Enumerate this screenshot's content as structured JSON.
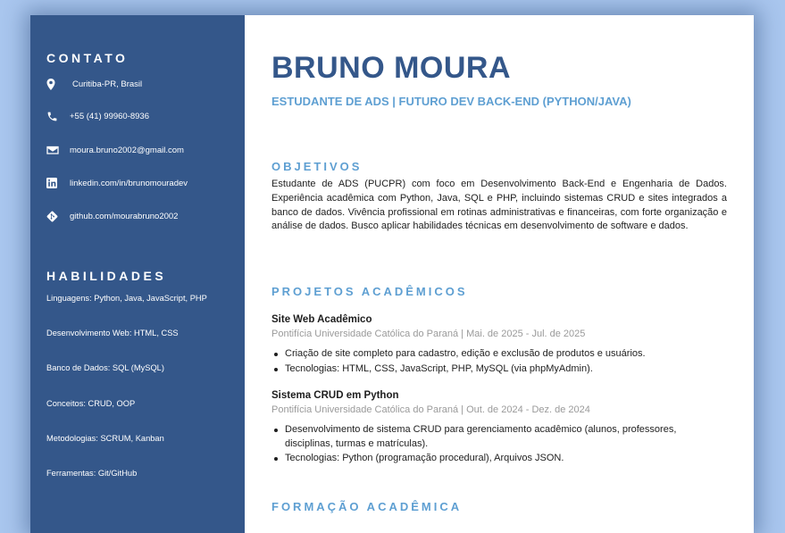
{
  "sidebar": {
    "contact_title": "CONTATO",
    "contacts": [
      {
        "icon": "location-pin-icon",
        "text": "Curitiba-PR, Brasil"
      },
      {
        "icon": "phone-icon",
        "text": "+55 (41) 99960-8936"
      },
      {
        "icon": "envelope-icon",
        "text": "moura.bruno2002@gmail.com"
      },
      {
        "icon": "linkedin-icon",
        "text": "linkedin.com/in/brunomouradev"
      },
      {
        "icon": "git-icon",
        "text": "github.com/mourabruno2002"
      }
    ],
    "skills_title": "HABILIDADES",
    "skills": [
      "Linguagens: Python, Java, JavaScript, PHP",
      "Desenvolvimento Web: HTML, CSS",
      "Banco de Dados: SQL (MySQL)",
      "Conceitos: CRUD, OOP",
      "Metodologias: SCRUM, Kanban",
      "Ferramentas: Git/GitHub"
    ]
  },
  "header": {
    "name": "BRUNO MOURA",
    "subtitle": "ESTUDANTE DE ADS | FUTURO DEV BACK-END (PYTHON/JAVA)"
  },
  "objectives": {
    "title": "OBJETIVOS",
    "text": "Estudante de ADS (PUCPR) com foco em Desenvolvimento Back-End e Engenharia de Dados. Experiência acadêmica com Python, Java, SQL e PHP, incluindo sistemas CRUD e sites integrados a banco de dados. Vivência profissional em rotinas administrativas e financeiras, com forte organização e análise de dados. Busco aplicar habilidades técnicas em desenvolvimento de software e dados."
  },
  "projects": {
    "title": "PROJETOS ACADÊMICOS",
    "items": [
      {
        "name": "Site Web Acadêmico",
        "meta": "Pontifícia Universidade Católica do Paraná | Mai. de 2025 - Jul. de 2025",
        "bullets": [
          "Criação de site completo para cadastro, edição e exclusão de produtos e usuários.",
          "Tecnologias: HTML, CSS, JavaScript, PHP, MySQL (via phpMyAdmin)."
        ]
      },
      {
        "name": "Sistema CRUD em Python",
        "meta": "Pontifícia Universidade Católica do Paraná | Out. de 2024 - Dez. de 2024",
        "bullets": [
          "Desenvolvimento de sistema CRUD para gerenciamento acadêmico (alunos, professores, disciplinas, turmas e matrículas).",
          "Tecnologias: Python (programação procedural), Arquivos JSON."
        ]
      }
    ]
  },
  "education": {
    "title": "FORMAÇÃO ACADÊMICA"
  },
  "colors": {
    "sidebar_bg": "#34578a",
    "accent": "#5e9fd2",
    "name": "#34578a",
    "page_bg": "#a9c6ee"
  }
}
